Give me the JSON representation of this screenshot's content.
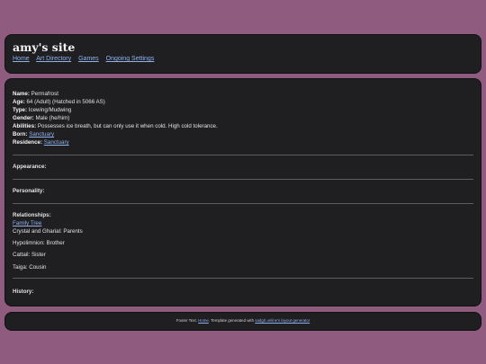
{
  "site": {
    "title": "amy's site",
    "nav": [
      "Home",
      "Art Directory",
      "Games",
      "Ongoing Settings"
    ]
  },
  "profile": {
    "name_label": "Name:",
    "name": "Permafrost",
    "age_label": "Age:",
    "age": "64 (Adult) (Hatched in 5066 AS)",
    "type_label": "Type:",
    "type": "Icewing/Mudwing",
    "gender_label": "Gender:",
    "gender": "Male (he/him)",
    "abilities_label": "Abilities:",
    "abilities": "Possesses ice breath, but can only use it when cold. High cold tolerance.",
    "born_label": "Born:",
    "born": "Sanctuary",
    "residence_label": "Residence:",
    "residence": "Sanctuary"
  },
  "sections": {
    "appearance": "Appearance:",
    "personality": "Personality:",
    "relationships": "Relationships:",
    "history": "History:"
  },
  "relationships": {
    "family_tree": "Family Tree",
    "parents": "Crystal and Gharial: Parents",
    "brother": "Hypolimnion: Brother",
    "sister": "Cattail: Sister",
    "cousin": "Taiga: Cousin"
  },
  "footer": {
    "prefix": "Footer Text. ",
    "home": "Home",
    "middle": ". Template generated with ",
    "generator": "sadgrl.online's layout generator",
    "suffix": ""
  },
  "colors": {
    "page_background": "#8f5c7f",
    "panel_background": "#1f1f21",
    "link": "#8fb1ec"
  }
}
